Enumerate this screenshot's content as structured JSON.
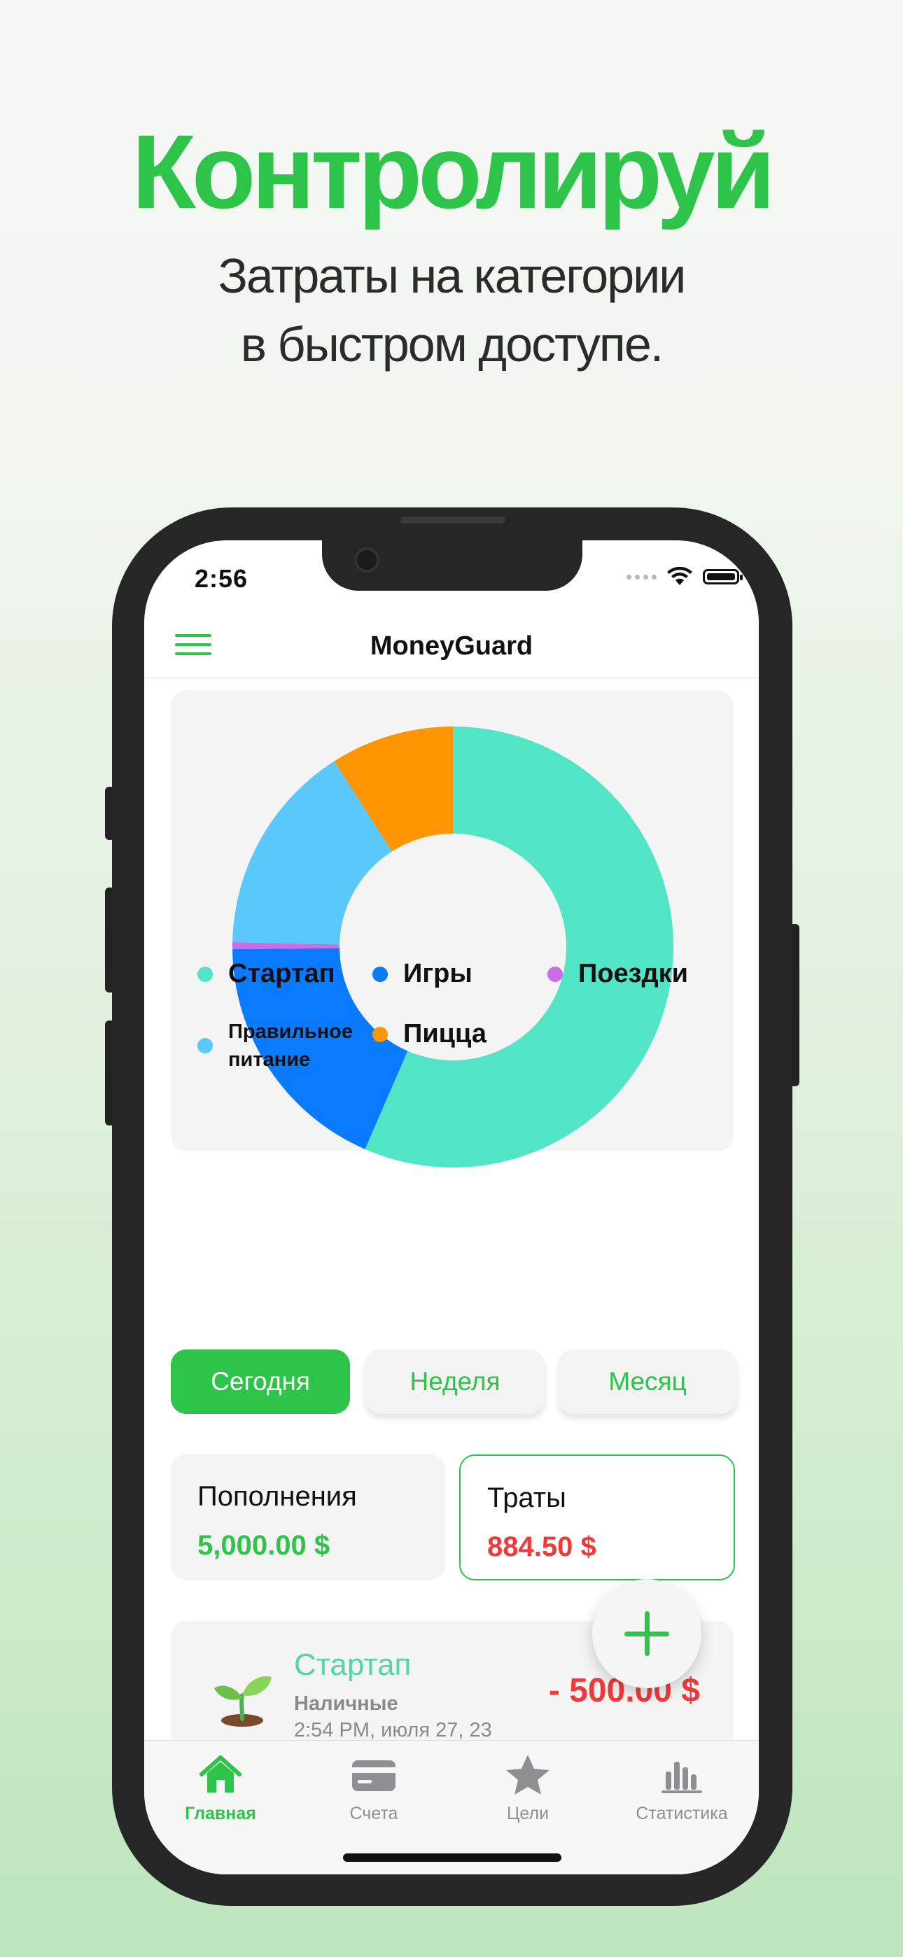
{
  "promo": {
    "title": "Контролируй",
    "subtitle_line1": "Затраты на категории",
    "subtitle_line2": "в быстром доступе."
  },
  "status_bar": {
    "time": "2:56"
  },
  "header": {
    "app_title": "MoneyGuard",
    "menu_icon": "hamburger-icon"
  },
  "chart_data": {
    "type": "pie",
    "style": "donut",
    "series": [
      {
        "name": "Стартап",
        "value": 500.0,
        "color": "#52e5c5"
      },
      {
        "name": "Игры",
        "value": 162.0,
        "color": "#0a7bff"
      },
      {
        "name": "Поездки",
        "value": 4.5,
        "color": "#c86ee6"
      },
      {
        "name": "Правильное питание",
        "value": 138.0,
        "color": "#5ac8fb"
      },
      {
        "name": "Пицца",
        "value": 80.0,
        "color": "#ff9500"
      }
    ],
    "legend": [
      "Стартап",
      "Игры",
      "Поездки",
      "Правильное питание",
      "Пицца"
    ],
    "legend_placement": "bottom"
  },
  "legend": {
    "startup": "Стартап",
    "games": "Игры",
    "trips": "Поездки",
    "nutrition": "Правильное питание",
    "pizza": "Пицца"
  },
  "period": {
    "today": "Сегодня",
    "week": "Неделя",
    "month": "Месяц",
    "selected": "Сегодня"
  },
  "summary": {
    "income_label": "Пополнения",
    "income_value": "5,000.00 $",
    "expense_label": "Траты",
    "expense_value": "884.50 $"
  },
  "transaction": {
    "emoji_icon": "seedling-icon",
    "category": "Стартап",
    "account": "Наличные",
    "datetime": "2:54 PM, июля 27, 23",
    "amount": "- 500.00 $"
  },
  "fab": {
    "icon": "plus-icon"
  },
  "tabbar": {
    "home": "Главная",
    "accounts": "Счета",
    "goals": "Цели",
    "stats": "Статистика",
    "active": "Главная"
  },
  "colors": {
    "accent": "#2ec44a",
    "expense": "#f03a3a",
    "startup": "#52e5c5"
  }
}
